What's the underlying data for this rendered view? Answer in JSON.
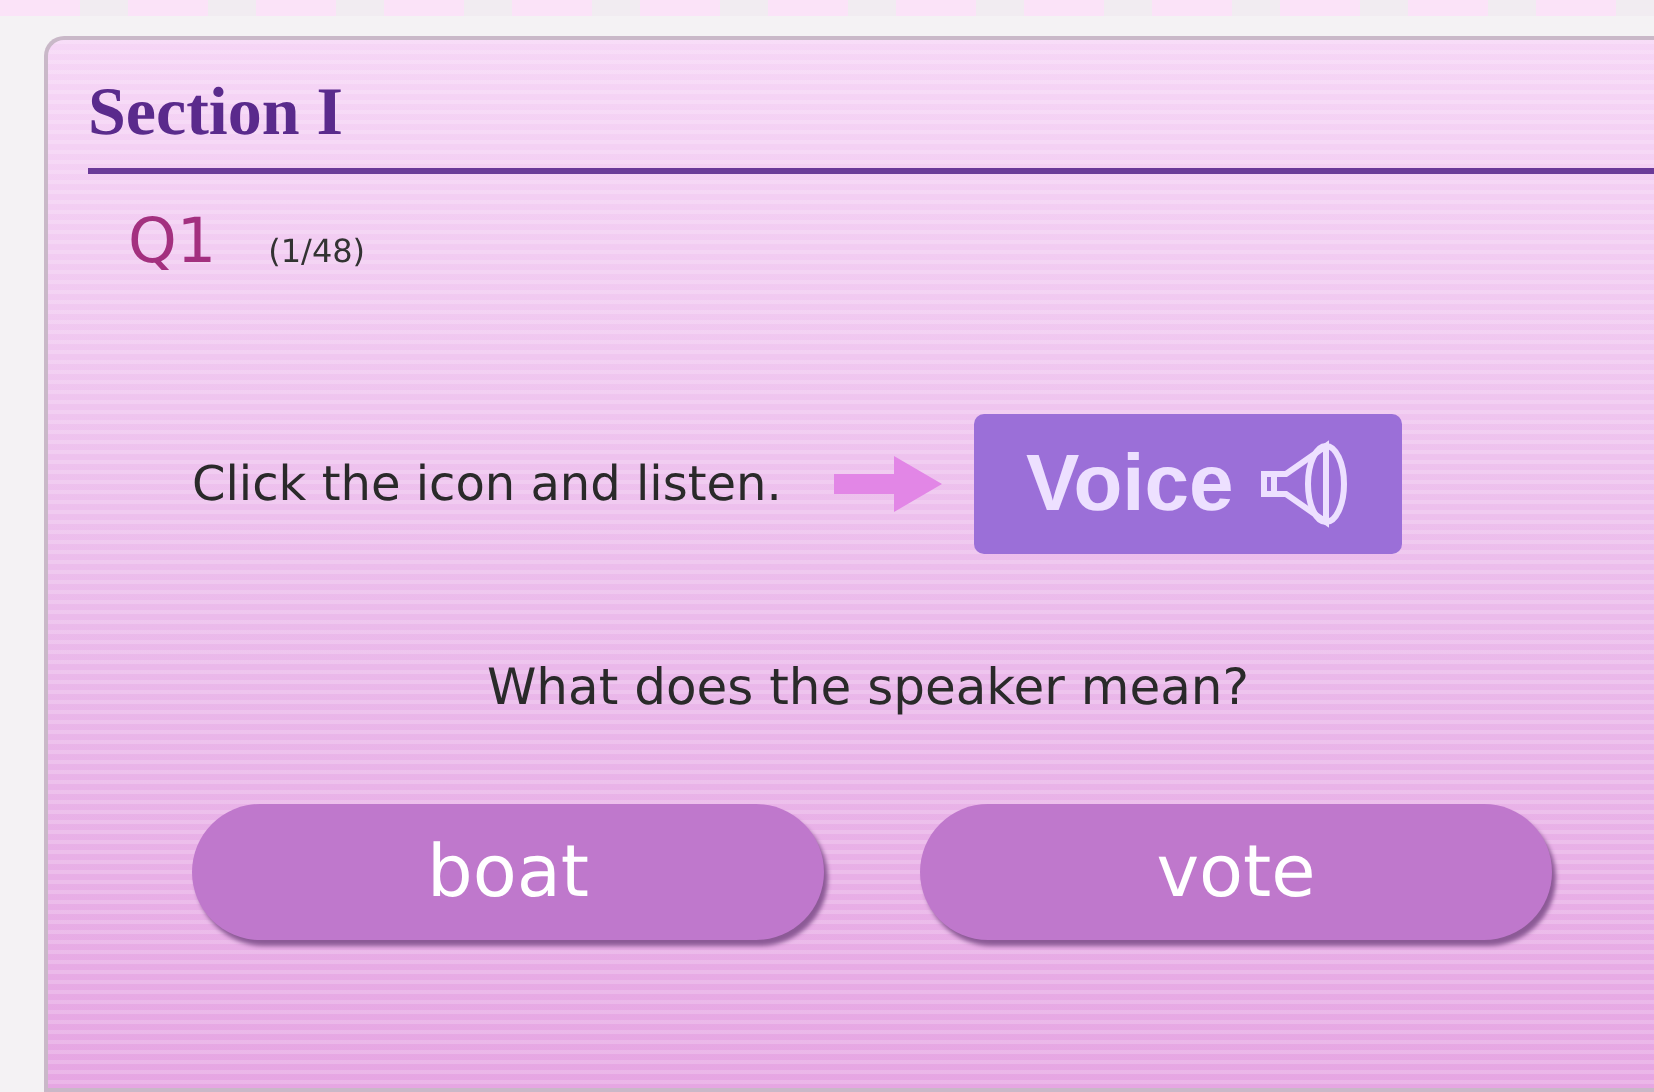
{
  "section": {
    "title": "Section I"
  },
  "question": {
    "number": "Q1",
    "progress": "(1/48)"
  },
  "instruction": {
    "text": "Click the icon and listen.",
    "button": "Voice"
  },
  "prompt": "What does the speaker mean?",
  "answers": [
    {
      "label": "boat"
    },
    {
      "label": "vote"
    }
  ]
}
